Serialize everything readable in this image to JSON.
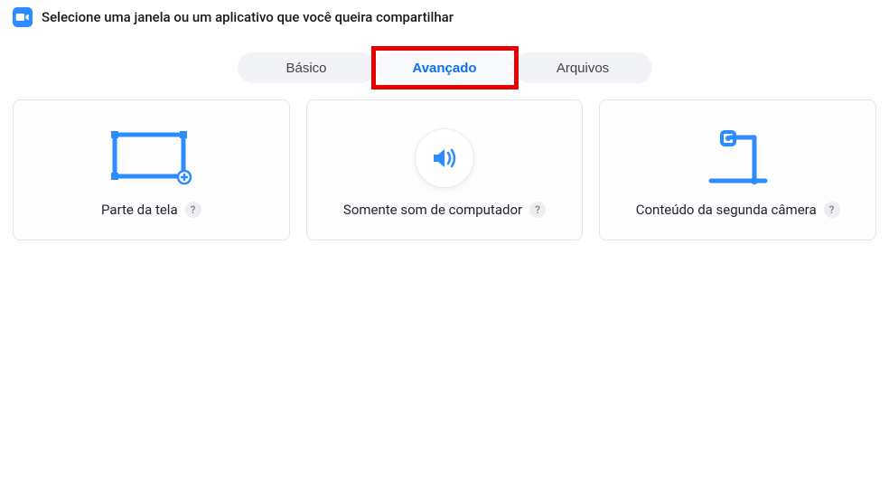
{
  "header": {
    "title": "Selecione uma janela ou um aplicativo que você queira compartilhar"
  },
  "tabs": {
    "basic": "Básico",
    "advanced": "Avançado",
    "files": "Arquivos"
  },
  "cards": {
    "portion": {
      "label": "Parte da tela",
      "help": "?"
    },
    "audio": {
      "label": "Somente som de computador",
      "help": "?"
    },
    "camera": {
      "label": "Conteúdo da segunda câmera",
      "help": "?"
    }
  },
  "colors": {
    "accent": "#2D8CFF",
    "highlight": "#E60000"
  }
}
